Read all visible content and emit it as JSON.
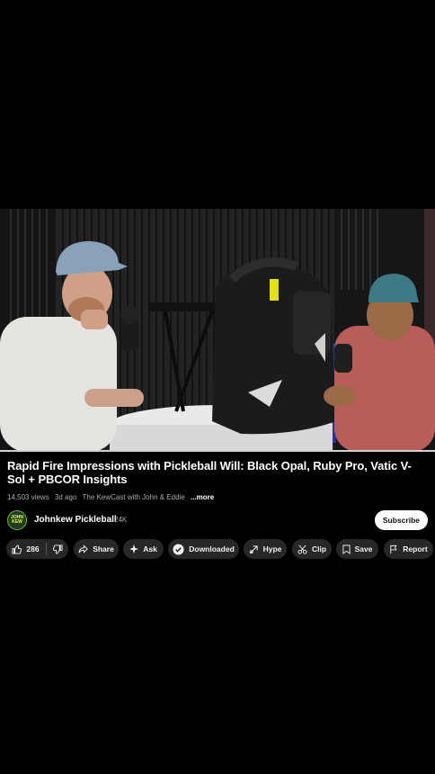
{
  "video": {
    "watched_fraction": 1.0
  },
  "title": "Rapid Fire Impressions with Pickleball Will: Black Opal, Ruby Pro, Vatic V-Sol + PBCOR Insights",
  "meta": {
    "views": "14,503 views",
    "age": "3d ago",
    "tags": "The KewCast with John & Eddie",
    "more": "...more"
  },
  "channel": {
    "avatar_text": "JOHN KEW",
    "name": "Johnkew Pickleball",
    "subscribers": "24K",
    "subscribe_label": "Subscribe"
  },
  "actions": {
    "likes": "286",
    "share": "Share",
    "ask": "Ask",
    "downloaded": "Downloaded",
    "hype": "Hype",
    "clip": "Clip",
    "save": "Save",
    "report": "Report"
  },
  "colors": {
    "background": "#000000",
    "pill": "#272727",
    "subscribe_bg": "#ffffff",
    "meta_text": "#aaaaaa"
  }
}
